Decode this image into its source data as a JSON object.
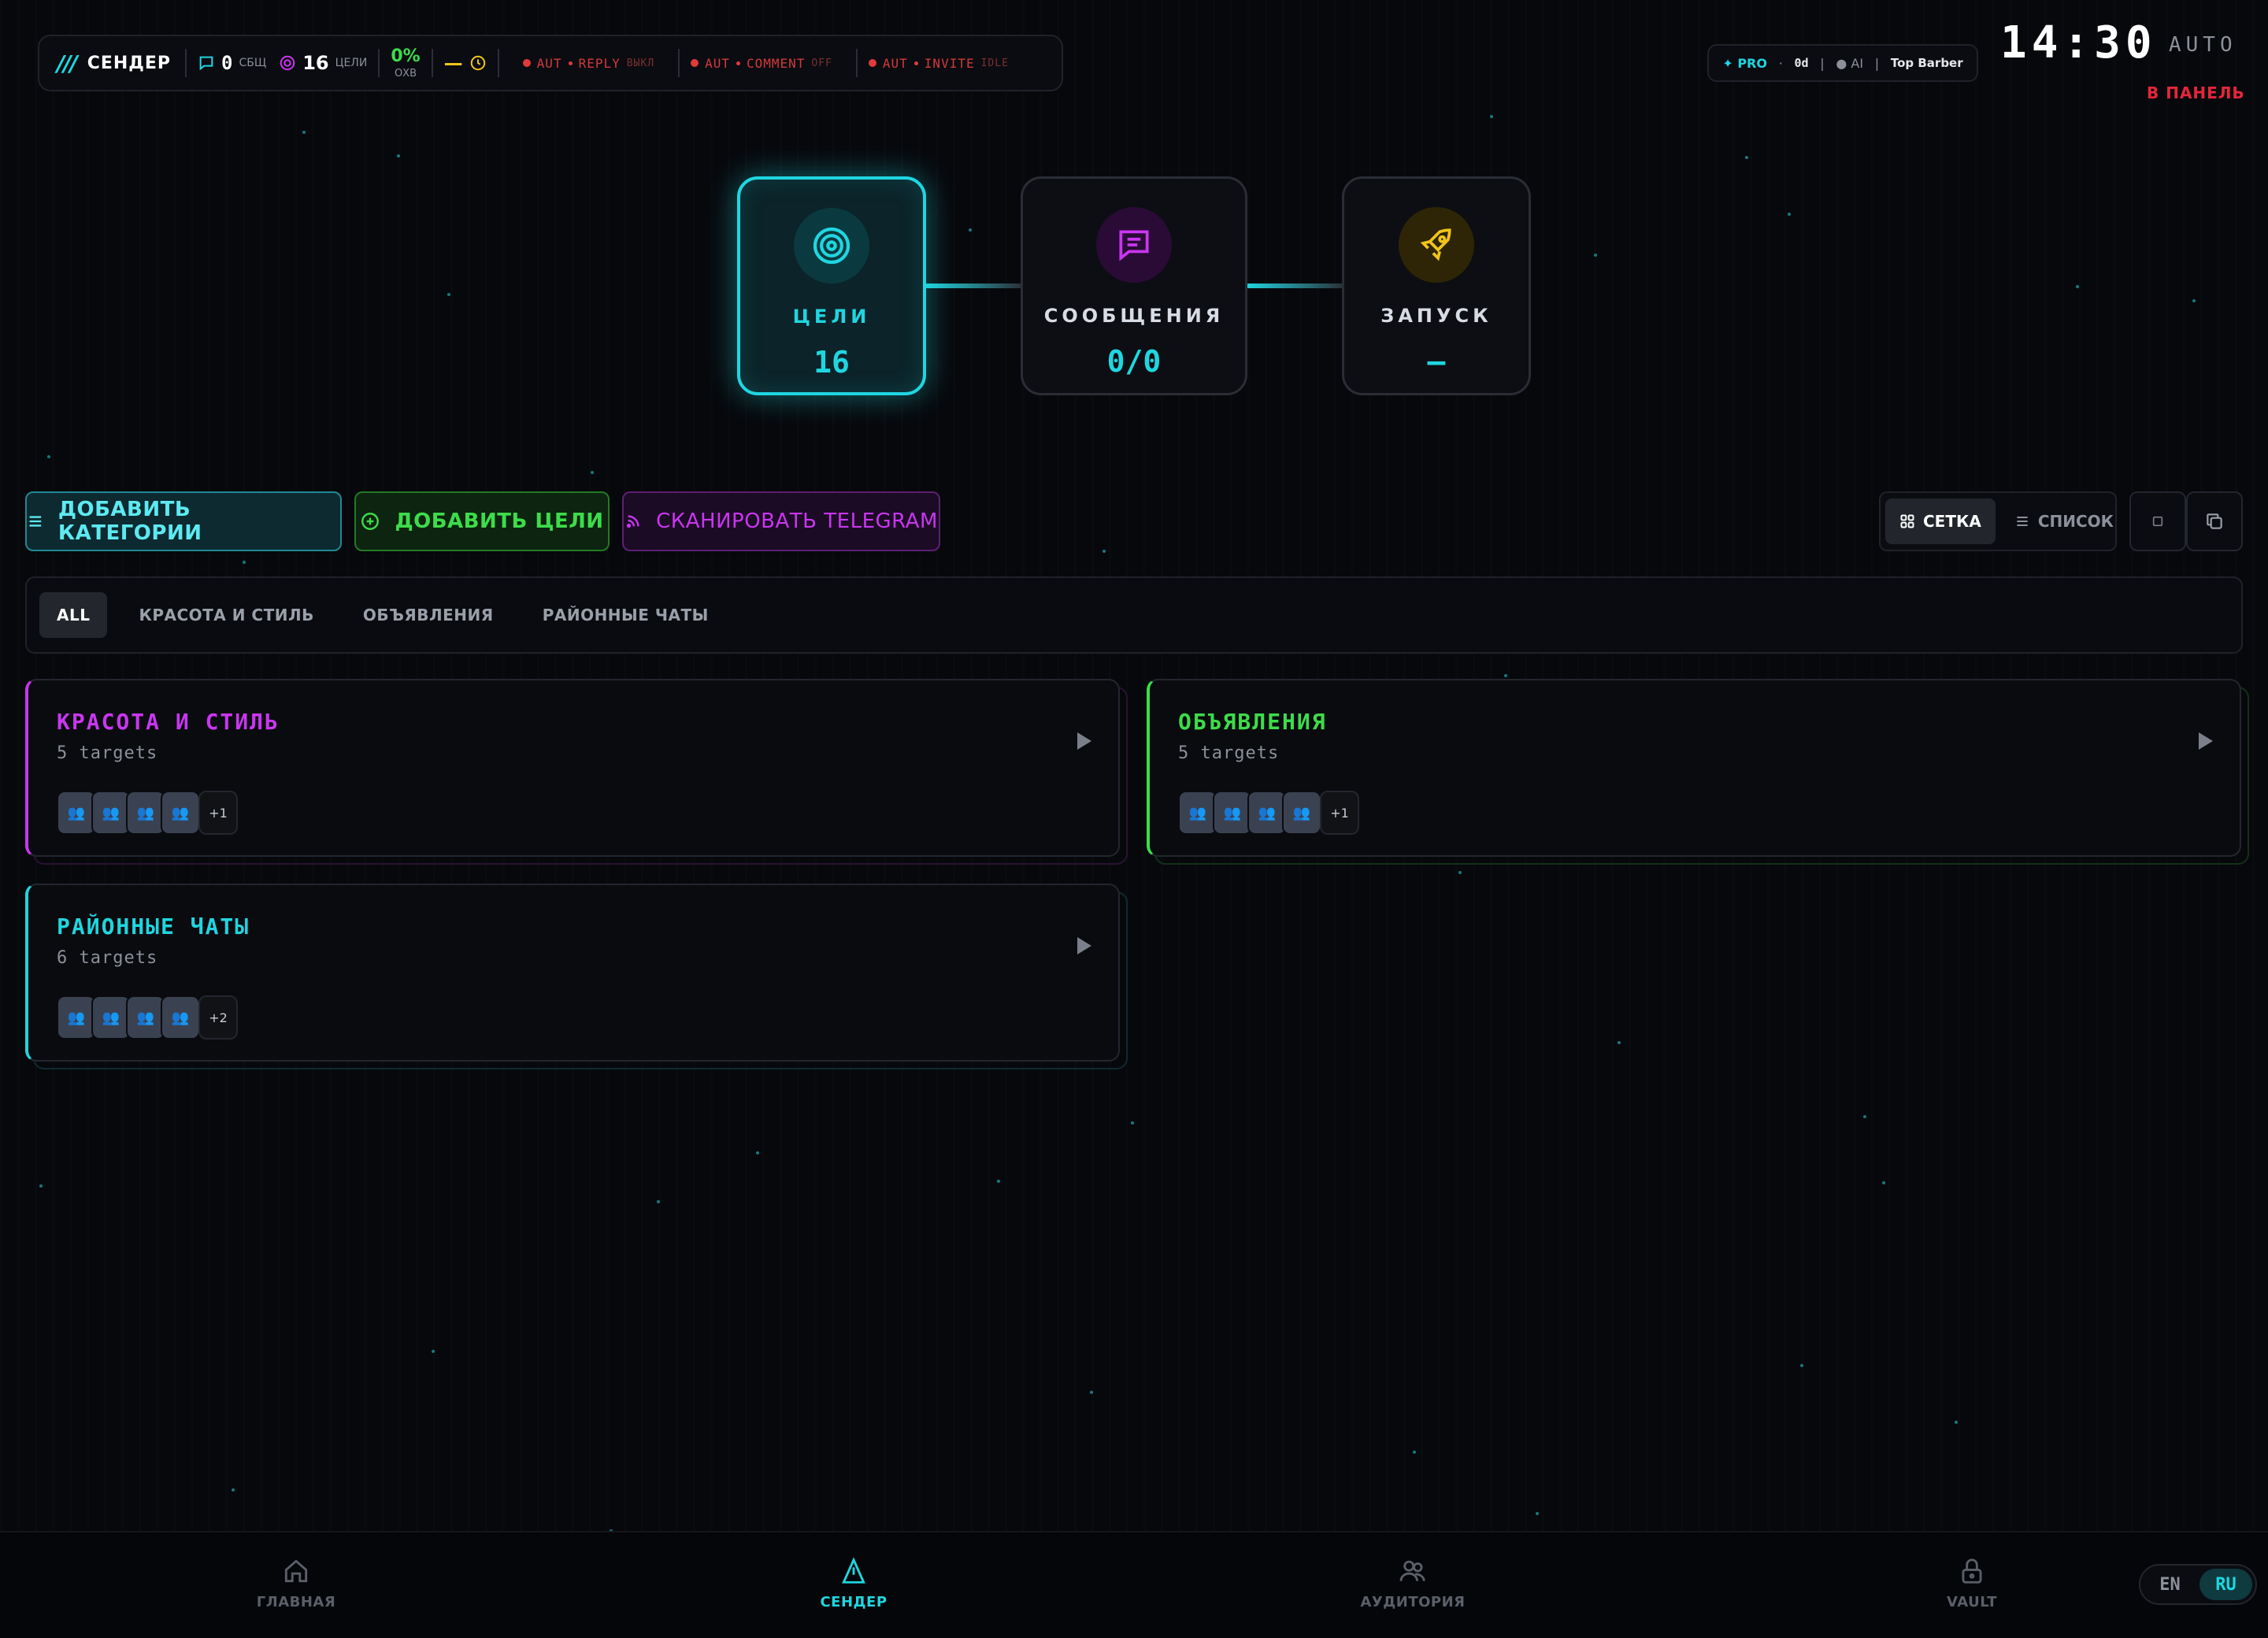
{
  "topbar": {
    "brand_slashes": "///",
    "brand_name": "СЕНДЕР",
    "messages_count": "0",
    "messages_label": "СБЩ",
    "targets_count": "16",
    "targets_label": "ЦЕЛИ",
    "reach_pct": "0%",
    "reach_label": "ОХВ",
    "timer_value": "—",
    "auto_items": [
      {
        "prefix": "AUT",
        "name": "REPLY",
        "state": "ВЫКЛ"
      },
      {
        "prefix": "AUT",
        "name": "COMMENT",
        "state": "OFF"
      },
      {
        "prefix": "AUT",
        "name": "INVITE",
        "state": "IDLE"
      }
    ]
  },
  "account": {
    "plan": "PRO",
    "days": "0d",
    "ai_label": "AI",
    "name": "Top Barber"
  },
  "clock": "14:30",
  "mode_label": "AUTO",
  "panel_link": "В ПАНЕЛЬ",
  "steps": [
    {
      "title": "ЦЕЛИ",
      "value": "16",
      "icon": "target-icon"
    },
    {
      "title": "СООБЩЕНИЯ",
      "value": "0/0",
      "icon": "message-icon"
    },
    {
      "title": "ЗАПУСК",
      "value": "—",
      "icon": "rocket-icon"
    }
  ],
  "actions": {
    "add_category": "ДОБАВИТЬ КАТЕГОРИИ",
    "add_targets": "ДОБАВИТЬ ЦЕЛИ",
    "scan_telegram": "СКАНИРОВАТЬ TELEGRAM"
  },
  "view_toggle": {
    "grid": "СЕТКА",
    "list": "СПИСОК",
    "selected": "grid"
  },
  "filters": [
    "ALL",
    "КРАСОТА И СТИЛЬ",
    "ОБЪЯВЛЕНИЯ",
    "РАЙОННЫЕ ЧАТЫ"
  ],
  "active_filter": "ALL",
  "categories": [
    {
      "title": "КРАСОТА И СТИЛЬ",
      "subtitle": "5 targets",
      "more": "+1",
      "color": "#c936f0"
    },
    {
      "title": "ОБЪЯВЛЕНИЯ",
      "subtitle": "5 targets",
      "more": "+1",
      "color": "#3ddc4a"
    },
    {
      "title": "РАЙОННЫЕ ЧАТЫ",
      "subtitle": "6 targets",
      "more": "+2",
      "color": "#1fd6e0"
    }
  ],
  "nav": {
    "home": "ГЛАВНАЯ",
    "sender": "СЕНДЕР",
    "audience": "АУДИТОРИЯ",
    "vault": "VAULT",
    "active": "sender"
  },
  "language": {
    "en": "EN",
    "ru": "RU",
    "selected": "RU"
  },
  "colors": {
    "accent_cyan": "#1fd6e0",
    "accent_green": "#3ddc4a",
    "accent_purple": "#c936f0",
    "accent_yellow": "#f0c419",
    "alert_red": "#e6263a",
    "background": "#07080c"
  }
}
